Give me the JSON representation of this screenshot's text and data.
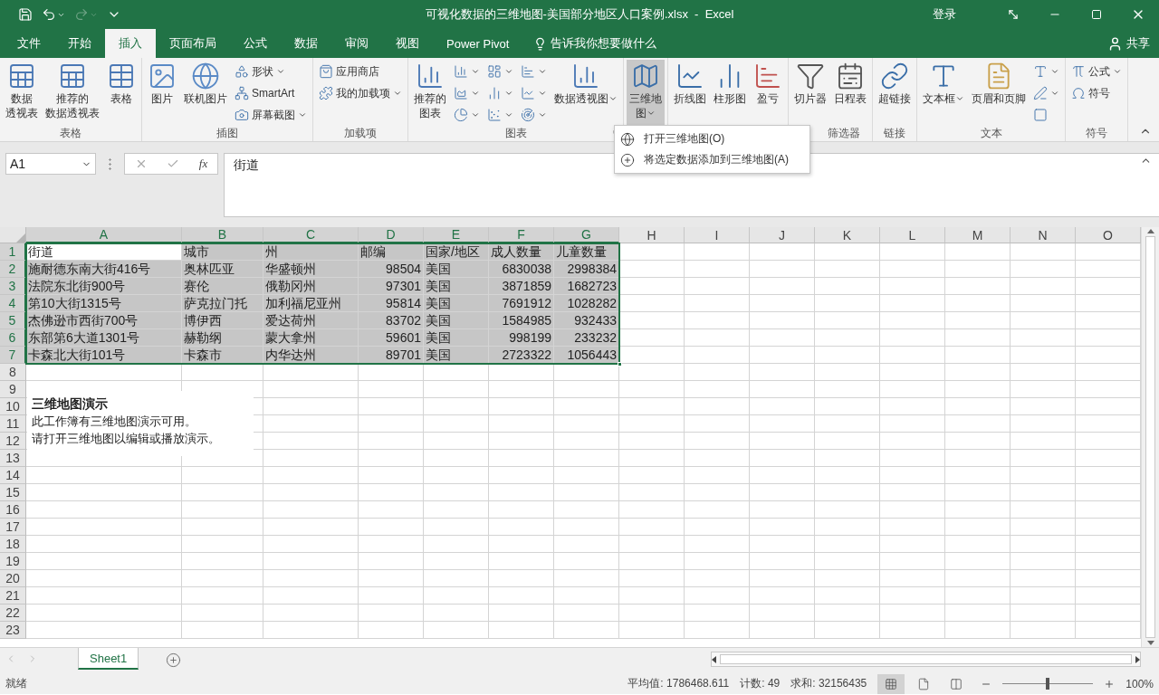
{
  "window": {
    "title": "可视化数据的三维地图-美国部分地区人口案例.xlsx  -  Excel",
    "sign_in": "登录"
  },
  "quick_access": [
    {
      "kind": "save",
      "disabled": false,
      "dropdown": false
    },
    {
      "kind": "undo",
      "disabled": false,
      "dropdown": true
    },
    {
      "kind": "redo",
      "disabled": true,
      "dropdown": true
    },
    {
      "kind": "customize",
      "disabled": false,
      "dropdown": false
    }
  ],
  "tabs": [
    {
      "label": "文件",
      "selected": false
    },
    {
      "label": "开始",
      "selected": false
    },
    {
      "label": "插入",
      "selected": true
    },
    {
      "label": "页面布局",
      "selected": false
    },
    {
      "label": "公式",
      "selected": false
    },
    {
      "label": "数据",
      "selected": false
    },
    {
      "label": "审阅",
      "selected": false
    },
    {
      "label": "视图",
      "selected": false
    },
    {
      "label": "Power Pivot",
      "selected": false
    }
  ],
  "tell_me": "告诉我你想要做什么",
  "share": "共享",
  "ribbon": [
    {
      "label": "表格",
      "items": [
        {
          "kind": "large",
          "label": [
            "数据",
            "透视表"
          ],
          "dropdown": false,
          "pressed": false
        },
        {
          "kind": "large",
          "label": [
            "推荐的",
            "数据透视表"
          ],
          "dropdown": false,
          "pressed": false
        },
        {
          "kind": "large",
          "label": [
            "表格"
          ],
          "dropdown": false,
          "pressed": false
        }
      ]
    },
    {
      "label": "插图",
      "items": [
        {
          "kind": "large",
          "label": [
            "图片"
          ],
          "dropdown": false,
          "pressed": false
        },
        {
          "kind": "large",
          "label": [
            "联机图片"
          ],
          "dropdown": false,
          "pressed": false
        },
        {
          "kind": "small",
          "label": "形状",
          "dropdown": true,
          "pressed": false
        },
        {
          "kind": "small",
          "label": "SmartArt",
          "dropdown": false,
          "pressed": false
        },
        {
          "kind": "small",
          "label": "屏幕截图",
          "dropdown": true,
          "pressed": false
        }
      ]
    },
    {
      "label": "加载项",
      "items": [
        {
          "kind": "small",
          "label": "应用商店",
          "dropdown": false,
          "pressed": false
        },
        {
          "kind": "small",
          "label": "我的加载项",
          "dropdown": true,
          "pressed": false
        }
      ]
    },
    {
      "label": "图表",
      "launcher": true,
      "items": [
        {
          "kind": "large",
          "label": [
            "推荐的",
            "图表"
          ],
          "dropdown": false,
          "pressed": false
        },
        {
          "kind": "icon",
          "dropdown": true,
          "pressed": false
        },
        {
          "kind": "icon",
          "dropdown": true,
          "pressed": false
        },
        {
          "kind": "icon",
          "dropdown": true,
          "pressed": false
        },
        {
          "kind": "icon",
          "dropdown": true,
          "pressed": false
        },
        {
          "kind": "icon",
          "dropdown": true,
          "pressed": false
        },
        {
          "kind": "icon",
          "dropdown": true,
          "pressed": false
        },
        {
          "kind": "icon",
          "dropdown": true,
          "pressed": false
        },
        {
          "kind": "icon",
          "dropdown": true,
          "pressed": false
        },
        {
          "kind": "icon",
          "dropdown": true,
          "pressed": false
        },
        {
          "kind": "large",
          "label": [
            "数据透视图"
          ],
          "dropdown": true,
          "pressed": false
        }
      ]
    },
    {
      "items": [
        {
          "kind": "large",
          "label": [
            "三维地",
            "图"
          ],
          "dropdown": true,
          "pressed": true
        }
      ]
    },
    {
      "items": [
        {
          "kind": "large",
          "label": [
            "折线图"
          ],
          "dropdown": false,
          "pressed": false
        },
        {
          "kind": "large",
          "label": [
            "柱形图"
          ],
          "dropdown": false,
          "pressed": false
        },
        {
          "kind": "large",
          "label": [
            "盈亏"
          ],
          "dropdown": false,
          "pressed": false
        }
      ]
    },
    {
      "label": "筛选器",
      "items": [
        {
          "kind": "large",
          "label": [
            "切片器"
          ],
          "dropdown": false,
          "pressed": false
        },
        {
          "kind": "large",
          "label": [
            "日程表"
          ],
          "dropdown": false,
          "pressed": false
        }
      ]
    },
    {
      "label": "链接",
      "items": [
        {
          "kind": "large",
          "label": [
            "超链接"
          ],
          "dropdown": false,
          "pressed": false
        }
      ]
    },
    {
      "label": "文本",
      "items": [
        {
          "kind": "large",
          "label": [
            "文本框"
          ],
          "dropdown": true,
          "pressed": false
        },
        {
          "kind": "large",
          "label": [
            "页眉和页脚"
          ],
          "dropdown": false,
          "pressed": false
        },
        {
          "kind": "icon",
          "dropdown": true,
          "pressed": false
        },
        {
          "kind": "icon",
          "dropdown": true,
          "pressed": false
        },
        {
          "kind": "icon",
          "dropdown": false,
          "pressed": false
        }
      ]
    },
    {
      "label": "符号",
      "items": [
        {
          "kind": "small",
          "label": "公式",
          "dropdown": true,
          "pressed": false
        },
        {
          "kind": "small",
          "label": "符号",
          "dropdown": false,
          "pressed": false
        }
      ]
    }
  ],
  "menu": {
    "items": [
      {
        "label": "打开三维地图(O)"
      },
      {
        "label": "将选定数据添加到三维地图(A)"
      }
    ]
  },
  "formula_bar": {
    "name_box": "A1",
    "fx_label": "fx",
    "formula": "街道"
  },
  "columns": [
    {
      "label": "A",
      "selected": true,
      "kind": "text"
    },
    {
      "label": "B",
      "selected": true,
      "kind": "text"
    },
    {
      "label": "C",
      "selected": true,
      "kind": "text"
    },
    {
      "label": "D",
      "selected": true,
      "kind": "number"
    },
    {
      "label": "E",
      "selected": true,
      "kind": "text"
    },
    {
      "label": "F",
      "selected": true,
      "kind": "number"
    },
    {
      "label": "G",
      "selected": true,
      "kind": "number"
    },
    {
      "label": "H",
      "selected": false
    },
    {
      "label": "I",
      "selected": false
    },
    {
      "label": "J",
      "selected": false
    },
    {
      "label": "K",
      "selected": false
    },
    {
      "label": "L",
      "selected": false
    },
    {
      "label": "M",
      "selected": false
    },
    {
      "label": "N",
      "selected": false
    },
    {
      "label": "O",
      "selected": false
    }
  ],
  "row_headers": [
    {
      "label": "1",
      "selected": true
    },
    {
      "label": "2",
      "selected": true
    },
    {
      "label": "3",
      "selected": true
    },
    {
      "label": "4",
      "selected": true
    },
    {
      "label": "5",
      "selected": true
    },
    {
      "label": "6",
      "selected": true
    },
    {
      "label": "7",
      "selected": true
    },
    {
      "label": "8",
      "selected": false
    },
    {
      "label": "9",
      "selected": false
    },
    {
      "label": "10",
      "selected": false
    },
    {
      "label": "11",
      "selected": false
    },
    {
      "label": "12",
      "selected": false
    },
    {
      "label": "13",
      "selected": false
    },
    {
      "label": "14",
      "selected": false
    },
    {
      "label": "15",
      "selected": false
    },
    {
      "label": "16",
      "selected": false
    },
    {
      "label": "17",
      "selected": false
    },
    {
      "label": "18",
      "selected": false
    },
    {
      "label": "19",
      "selected": false
    },
    {
      "label": "20",
      "selected": false
    },
    {
      "label": "21",
      "selected": false
    },
    {
      "label": "22",
      "selected": false
    },
    {
      "label": "23",
      "selected": false
    }
  ],
  "rows": [
    {
      "kind": "header",
      "cells": [
        {
          "text": "街道",
          "active": true
        },
        {
          "text": "城市",
          "active": false
        },
        {
          "text": "州",
          "active": false
        },
        {
          "text": "邮编",
          "active": false
        },
        {
          "text": "国家/地区",
          "active": false
        },
        {
          "text": "成人数量",
          "active": false
        },
        {
          "text": "儿童数量",
          "active": false
        }
      ]
    },
    {
      "kind": "data",
      "cells": [
        {
          "text": "施耐德东南大街416号",
          "active": false
        },
        {
          "text": "奥林匹亚",
          "active": false
        },
        {
          "text": "华盛顿州",
          "active": false
        },
        {
          "text": "98504",
          "active": false
        },
        {
          "text": "美国",
          "active": false
        },
        {
          "text": "6830038",
          "active": false
        },
        {
          "text": "2998384",
          "active": false
        }
      ]
    },
    {
      "kind": "data",
      "cells": [
        {
          "text": "法院东北街900号",
          "active": false
        },
        {
          "text": "赛伦",
          "active": false
        },
        {
          "text": "俄勒冈州",
          "active": false
        },
        {
          "text": "97301",
          "active": false
        },
        {
          "text": "美国",
          "active": false
        },
        {
          "text": "3871859",
          "active": false
        },
        {
          "text": "1682723",
          "active": false
        }
      ]
    },
    {
      "kind": "data",
      "cells": [
        {
          "text": "第10大街1315号",
          "active": false
        },
        {
          "text": "萨克拉门托",
          "active": false
        },
        {
          "text": "加利福尼亚州",
          "active": false
        },
        {
          "text": "95814",
          "active": false
        },
        {
          "text": "美国",
          "active": false
        },
        {
          "text": "7691912",
          "active": false
        },
        {
          "text": "1028282",
          "active": false
        }
      ]
    },
    {
      "kind": "data",
      "cells": [
        {
          "text": "杰佛逊市西街700号",
          "active": false
        },
        {
          "text": "博伊西",
          "active": false
        },
        {
          "text": "爱达荷州",
          "active": false
        },
        {
          "text": "83702",
          "active": false
        },
        {
          "text": "美国",
          "active": false
        },
        {
          "text": "1584985",
          "active": false
        },
        {
          "text": "932433",
          "active": false
        }
      ]
    },
    {
      "kind": "data",
      "cells": [
        {
          "text": "东部第6大道1301号",
          "active": false
        },
        {
          "text": "赫勒纲",
          "active": false
        },
        {
          "text": "蒙大拿州",
          "active": false
        },
        {
          "text": "59601",
          "active": false
        },
        {
          "text": "美国",
          "active": false
        },
        {
          "text": "998199",
          "active": false
        },
        {
          "text": "233232",
          "active": false
        }
      ]
    },
    {
      "kind": "data",
      "cells": [
        {
          "text": "卡森北大街101号",
          "active": false
        },
        {
          "text": "卡森市",
          "active": false
        },
        {
          "text": "内华达州",
          "active": false
        },
        {
          "text": "89701",
          "active": false
        },
        {
          "text": "美国",
          "active": false
        },
        {
          "text": "2723322",
          "active": false
        },
        {
          "text": "1056443",
          "active": false
        }
      ]
    }
  ],
  "text_box": {
    "title": "三维地图演示",
    "lines": [
      "此工作簿有三维地图演示可用。",
      "请打开三维地图以编辑或播放演示。"
    ]
  },
  "sheet_tabs": [
    {
      "label": "Sheet1",
      "selected": true
    }
  ],
  "status": {
    "ready": "就绪",
    "average": "平均值: 1786468.611",
    "count": "计数: 49",
    "sum": "求和: 32156435",
    "views": [
      {
        "kind": "normal",
        "selected": true
      },
      {
        "kind": "page_layout",
        "selected": false
      },
      {
        "kind": "page_break",
        "selected": false
      }
    ],
    "zoom": {
      "level": 0.5,
      "label": "100%"
    }
  }
}
